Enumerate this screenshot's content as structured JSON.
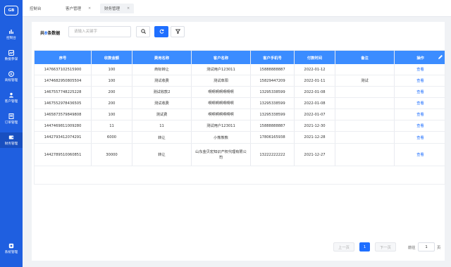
{
  "brand": {
    "logo_text": "GB"
  },
  "sidebar": {
    "items": [
      {
        "label": "控制台"
      },
      {
        "label": "数据参谋"
      },
      {
        "label": "商标管理"
      },
      {
        "label": "客户管理"
      },
      {
        "label": "订单管理"
      },
      {
        "label": "财务管理"
      }
    ],
    "bottom": {
      "label": "系统管理"
    }
  },
  "tabs": [
    {
      "label": "控制台"
    },
    {
      "label": "客户管理",
      "close": "×"
    },
    {
      "label": "财务管理",
      "close": "×"
    }
  ],
  "toolbar": {
    "count_prefix": "共",
    "count": "8",
    "count_suffix": "条数据",
    "search_placeholder": "请输入关键字"
  },
  "table": {
    "headers": [
      "序号",
      "收款金额",
      "费用名称",
      "客户名称",
      "客户手机号",
      "付款时间",
      "备注",
      "操作"
    ],
    "rows": [
      [
        "1476637102515900",
        "100",
        "商标转让",
        "测试用户123011",
        "15888888887",
        "2022-01-12",
        "",
        "查看"
      ],
      [
        "1474682950805504",
        "100",
        "测试收费",
        "测试阜阳",
        "15829447209",
        "2022-01-11",
        "测试",
        "查看"
      ],
      [
        "1467557748225228",
        "200",
        "测试收款2",
        "啊啊啊啊啊啊啊",
        "13295338599",
        "2022-01-08",
        "",
        "查看"
      ],
      [
        "1467552978436505",
        "200",
        "测试收费",
        "啊啊啊啊啊啊啊",
        "13295338599",
        "2022-01-08",
        "",
        "查看"
      ],
      [
        "1465873579849808",
        "100",
        "测试费",
        "啊啊啊啊啊啊啊",
        "13295338599",
        "2022-01-07",
        "",
        "查看"
      ],
      [
        "1447469811009280",
        "11",
        "11",
        "测试用户123011",
        "15888888887",
        "2021-12-30",
        "",
        "查看"
      ],
      [
        "1442793412074291",
        "6000",
        "转让",
        "小熊熊熊",
        "17806165938",
        "2021-12-28",
        "",
        "查看"
      ],
      [
        "1442789510060851",
        "30000",
        "转让",
        "山东金贝宏知识产权代理有限公司",
        "13222222222",
        "2021-12-27",
        "",
        "查看"
      ]
    ]
  },
  "pagination": {
    "prev": "上一页",
    "page": "1",
    "next": "下一页",
    "goto_label": "前往",
    "goto_value": "1",
    "page_unit": "页"
  },
  "colors": {
    "sidebar": "#1f5fe0",
    "header": "#3b8cff",
    "primary": "#1f6fff"
  }
}
